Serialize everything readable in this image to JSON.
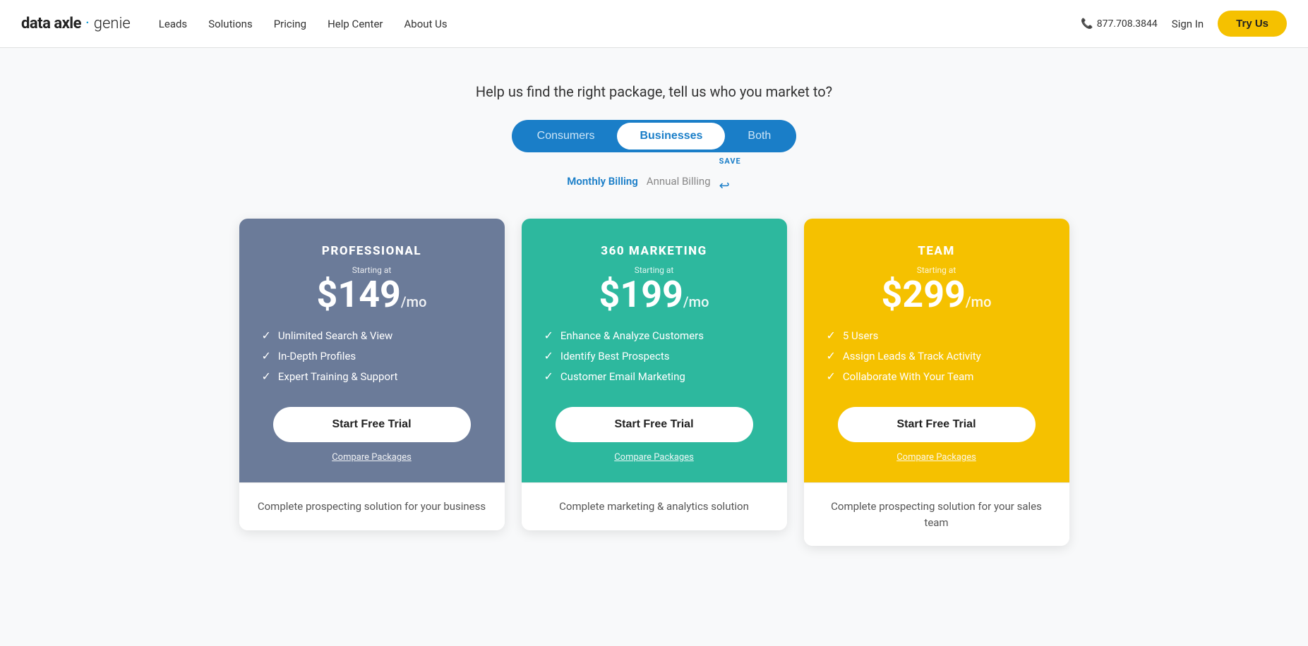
{
  "nav": {
    "logo_data_axle": "data axle",
    "logo_dot": "·",
    "logo_genie": "genie",
    "links": [
      "Leads",
      "Solutions",
      "Pricing",
      "Help Center",
      "About Us"
    ],
    "phone": "877.708.3844",
    "sign_in": "Sign In",
    "try_us": "Try Us"
  },
  "hero": {
    "tagline": "Help us find the right package, tell us who you market to?"
  },
  "segment": {
    "options": [
      "Consumers",
      "Businesses",
      "Both"
    ],
    "active": "Businesses"
  },
  "billing": {
    "monthly_label": "Monthly Billing",
    "annual_label": "Annual Billing",
    "save_label": "SAVE",
    "active": "monthly"
  },
  "plans": [
    {
      "id": "professional",
      "name": "PROFESSIONAL",
      "starting_at": "Starting at",
      "price": "$149",
      "per": "/mo",
      "features": [
        "Unlimited Search & View",
        "In-Depth Profiles",
        "Expert Training & Support"
      ],
      "cta": "Start Free Trial",
      "compare": "Compare Packages",
      "description": "Complete prospecting solution for your business"
    },
    {
      "id": "marketing",
      "name": "360 MARKETING",
      "starting_at": "Starting at",
      "price": "$199",
      "per": "/mo",
      "features": [
        "Enhance & Analyze Customers",
        "Identify Best Prospects",
        "Customer Email Marketing"
      ],
      "cta": "Start Free Trial",
      "compare": "Compare Packages",
      "description": "Complete marketing & analytics solution"
    },
    {
      "id": "team",
      "name": "TEAM",
      "starting_at": "Starting at",
      "price": "$299",
      "per": "/mo",
      "features": [
        "5 Users",
        "Assign Leads & Track Activity",
        "Collaborate With Your Team"
      ],
      "cta": "Start Free Trial",
      "compare": "Compare Packages",
      "description": "Complete prospecting solution for your sales team"
    }
  ]
}
